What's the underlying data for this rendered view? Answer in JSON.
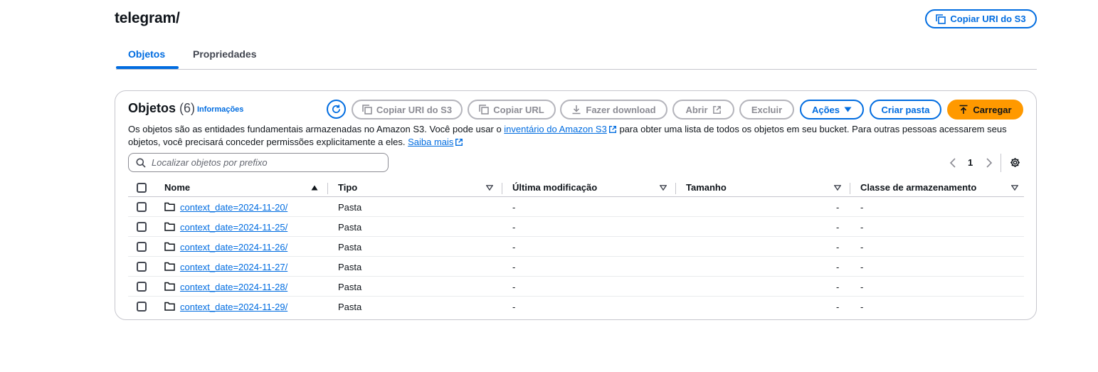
{
  "header": {
    "title": "telegram/",
    "copy_uri_label": "Copiar URI do S3"
  },
  "tabs": [
    {
      "label": "Objetos",
      "active": true
    },
    {
      "label": "Propriedades",
      "active": false
    }
  ],
  "objects_panel": {
    "title": "Objetos",
    "count": "(6)",
    "info_link": "Informações",
    "actions": {
      "copy_uri": "Copiar URI do S3",
      "copy_url": "Copiar URL",
      "download": "Fazer download",
      "open": "Abrir",
      "delete": "Excluir",
      "actions": "Ações",
      "create_folder": "Criar pasta",
      "upload": "Carregar"
    },
    "description": {
      "part1": "Os objetos são as entidades fundamentais armazenadas no Amazon S3. Você pode usar o ",
      "inventory_link": "inventário do Amazon S3",
      "part2": " para obter uma lista de todos os objetos em seu bucket. Para outras pessoas acessarem seus objetos, você precisará conceder permissões explicitamente a eles. ",
      "learn_more_link": "Saiba mais"
    },
    "search": {
      "placeholder": "Localizar objetos por prefixo",
      "value": ""
    },
    "pagination": {
      "current_page": "1"
    },
    "columns": [
      "Nome",
      "Tipo",
      "Última modificação",
      "Tamanho",
      "Classe de armazenamento"
    ],
    "rows": [
      {
        "name": "context_date=2024-11-20/",
        "type": "Pasta",
        "modified": "-",
        "size": "-",
        "storage_class": "-"
      },
      {
        "name": "context_date=2024-11-25/",
        "type": "Pasta",
        "modified": "-",
        "size": "-",
        "storage_class": "-"
      },
      {
        "name": "context_date=2024-11-26/",
        "type": "Pasta",
        "modified": "-",
        "size": "-",
        "storage_class": "-"
      },
      {
        "name": "context_date=2024-11-27/",
        "type": "Pasta",
        "modified": "-",
        "size": "-",
        "storage_class": "-"
      },
      {
        "name": "context_date=2024-11-28/",
        "type": "Pasta",
        "modified": "-",
        "size": "-",
        "storage_class": "-"
      },
      {
        "name": "context_date=2024-11-29/",
        "type": "Pasta",
        "modified": "-",
        "size": "-",
        "storage_class": "-"
      }
    ]
  },
  "colors": {
    "link_blue": "#006ce0",
    "primary_orange": "#ff9900",
    "disabled_grey": "#8c8c94",
    "border_grey": "#c6c6cd"
  },
  "icons": [
    "copy-icon",
    "refresh-icon",
    "download-icon",
    "external-link-icon",
    "caret-down-icon",
    "upload-icon",
    "search-icon",
    "chevron-left-icon",
    "chevron-right-icon",
    "settings-gear-icon",
    "sort-ascending-icon",
    "sort-descending-icon",
    "folder-icon",
    "checkbox-icon"
  ]
}
